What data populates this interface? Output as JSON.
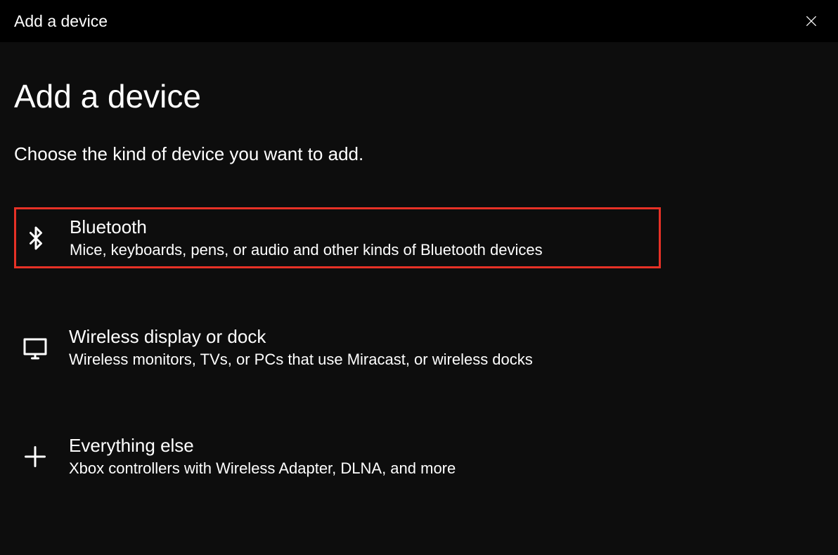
{
  "titlebar": {
    "title": "Add a device"
  },
  "main": {
    "heading": "Add a device",
    "subtitle": "Choose the kind of device you want to add.",
    "options": [
      {
        "title": "Bluetooth",
        "description": "Mice, keyboards, pens, or audio and other kinds of Bluetooth devices"
      },
      {
        "title": "Wireless display or dock",
        "description": "Wireless monitors, TVs, or PCs that use Miracast, or wireless docks"
      },
      {
        "title": "Everything else",
        "description": "Xbox controllers with Wireless Adapter, DLNA, and more"
      }
    ]
  }
}
